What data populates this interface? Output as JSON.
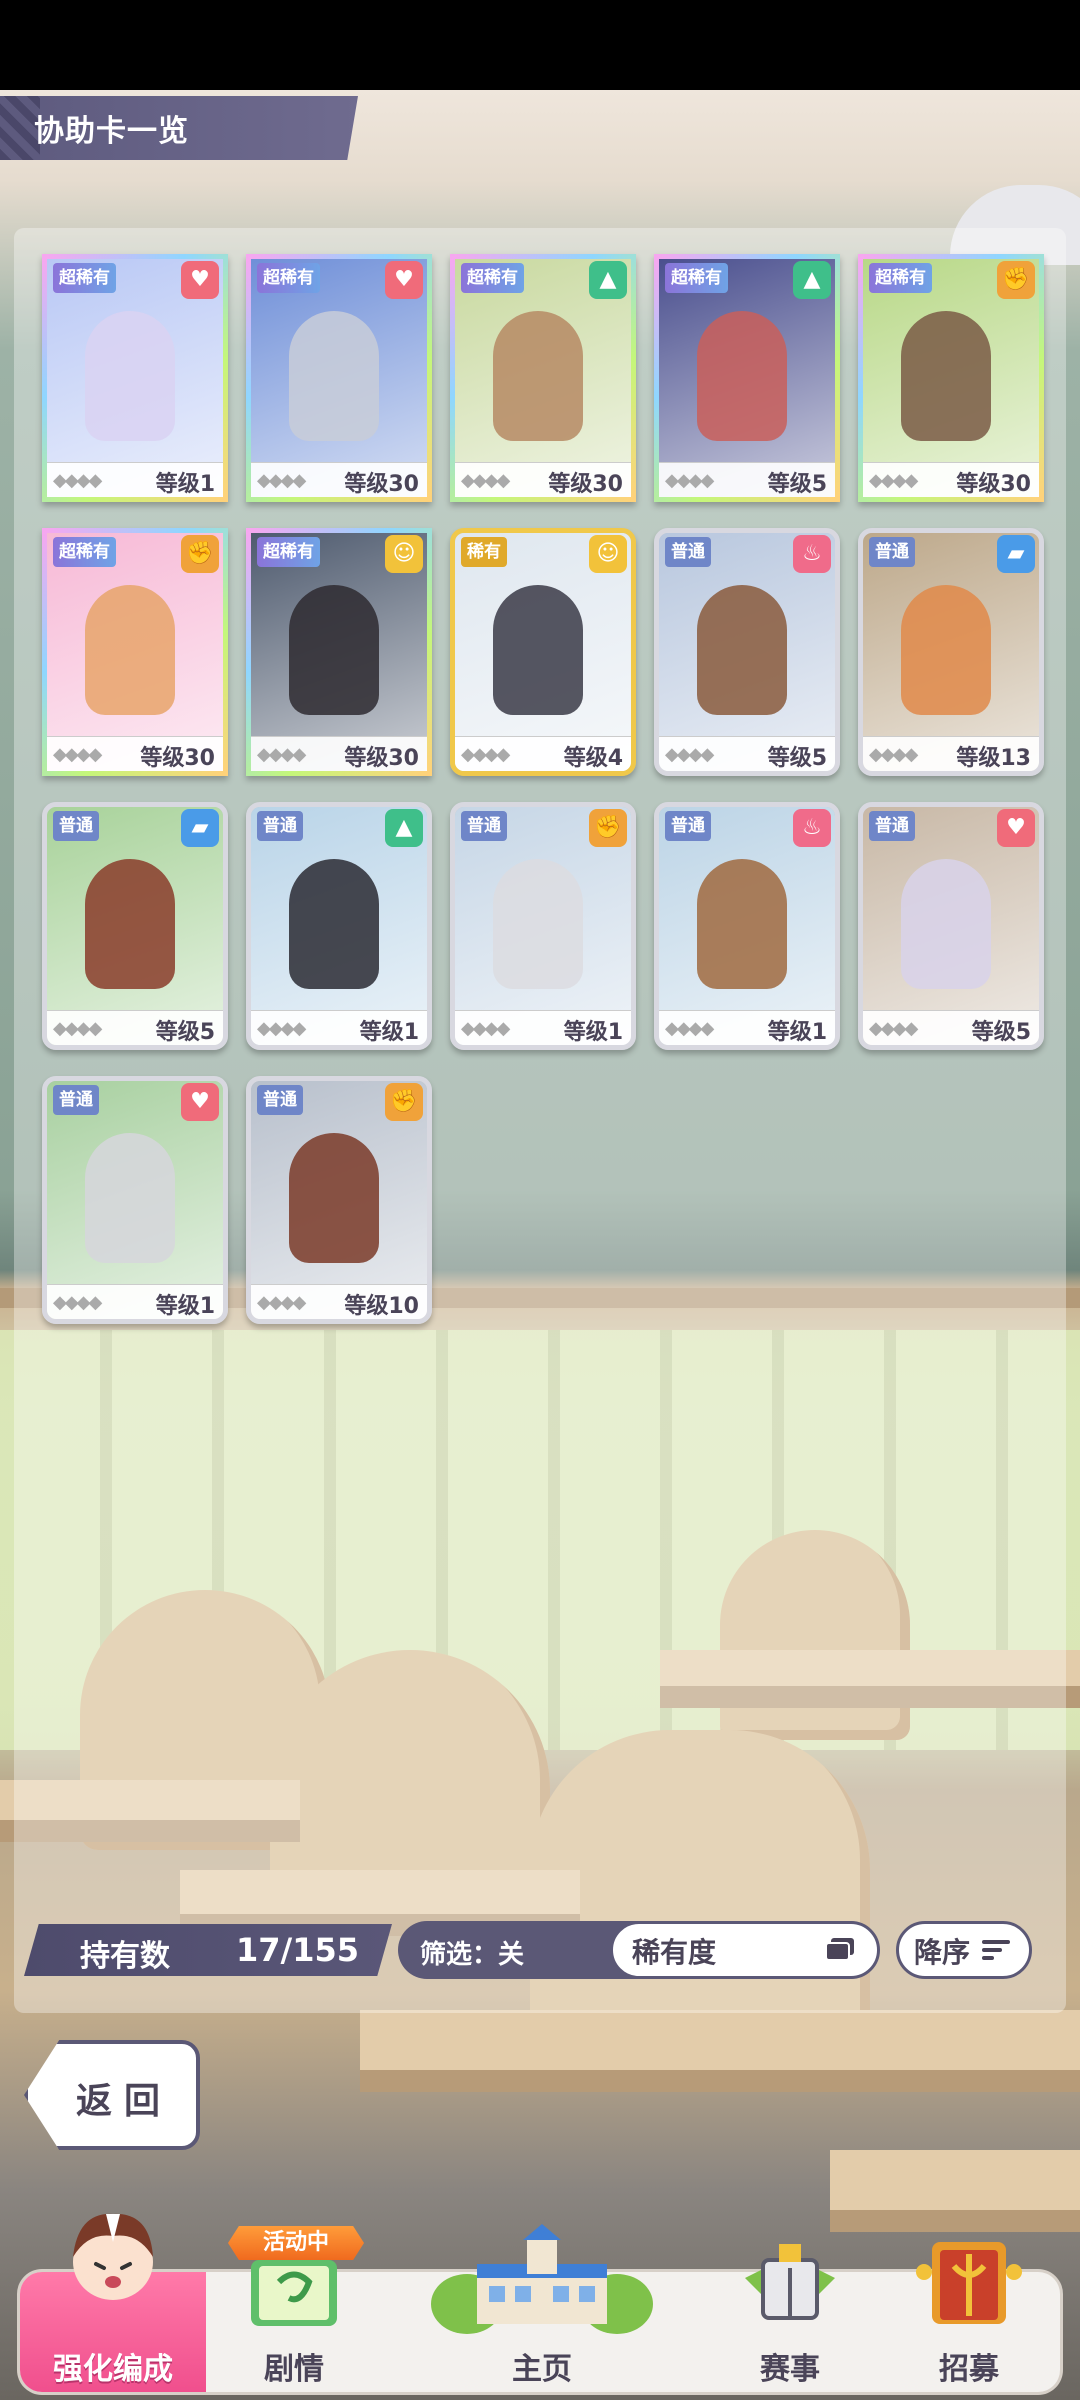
{
  "header": {
    "title": "协助卡一览"
  },
  "cards": [
    {
      "rarity": "超稀有",
      "type": "heart",
      "type_color": "#f06b7a",
      "level": "等级1",
      "art_color": "#b9c8f5",
      "char_color": "#d9d2f2",
      "tier": "ssr"
    },
    {
      "rarity": "超稀有",
      "type": "heart",
      "type_color": "#f06b7a",
      "level": "等级30",
      "art_color": "#6f8fd8",
      "char_color": "#c8cdd8",
      "tier": "ssr"
    },
    {
      "rarity": "超稀有",
      "type": "cap",
      "type_color": "#3fbf8a",
      "level": "等级30",
      "art_color": "#c9d9a0",
      "char_color": "#b68a64",
      "tier": "ssr"
    },
    {
      "rarity": "超稀有",
      "type": "cap",
      "type_color": "#3fbf8a",
      "level": "等级5",
      "art_color": "#4a4f8e",
      "char_color": "#c95f5a",
      "tier": "ssr"
    },
    {
      "rarity": "超稀有",
      "type": "muscle",
      "type_color": "#f0a23a",
      "level": "等级30",
      "art_color": "#b8d887",
      "char_color": "#7a5a45",
      "tier": "ssr"
    },
    {
      "rarity": "超稀有",
      "type": "muscle",
      "type_color": "#f0a23a",
      "level": "等级30",
      "art_color": "#f7b9d6",
      "char_color": "#e7a56b",
      "tier": "ssr"
    },
    {
      "rarity": "超稀有",
      "type": "smile",
      "type_color": "#f2c23a",
      "level": "等级30",
      "art_color": "#4e5a6e",
      "char_color": "#2e2a30",
      "tier": "ssr"
    },
    {
      "rarity": "稀有",
      "type": "smile",
      "type_color": "#f2c23a",
      "level": "等级4",
      "art_color": "#dfe7ef",
      "char_color": "#3a3a46",
      "tier": "sr"
    },
    {
      "rarity": "普通",
      "type": "fire",
      "type_color": "#f06b8a",
      "level": "等级5",
      "art_color": "#b8c7de",
      "char_color": "#8a5a3c",
      "tier": "r"
    },
    {
      "rarity": "普通",
      "type": "shoe",
      "type_color": "#4a9be8",
      "level": "等级13",
      "art_color": "#bda88a",
      "char_color": "#e08a4a",
      "tier": "r"
    },
    {
      "rarity": "普通",
      "type": "shoe",
      "type_color": "#4a9be8",
      "level": "等级5",
      "art_color": "#a8d29a",
      "char_color": "#8a3c2a",
      "tier": "r"
    },
    {
      "rarity": "普通",
      "type": "cap",
      "type_color": "#3fbf8a",
      "level": "等级1",
      "art_color": "#b9d4e8",
      "char_color": "#2a2a32",
      "tier": "r"
    },
    {
      "rarity": "普通",
      "type": "muscle",
      "type_color": "#f0a23a",
      "level": "等级1",
      "art_color": "#c6d6e6",
      "char_color": "#dcdce0",
      "tier": "r"
    },
    {
      "rarity": "普通",
      "type": "fire",
      "type_color": "#f06b8a",
      "level": "等级1",
      "art_color": "#bcd4e6",
      "char_color": "#a06a40",
      "tier": "r"
    },
    {
      "rarity": "普通",
      "type": "heart",
      "type_color": "#f06b7a",
      "level": "等级5",
      "art_color": "#c8b8a6",
      "char_color": "#d8d2ea",
      "tier": "r"
    },
    {
      "rarity": "普通",
      "type": "heart",
      "type_color": "#f06b7a",
      "level": "等级1",
      "art_color": "#a8d0a0",
      "char_color": "#d6d6dc",
      "tier": "r"
    },
    {
      "rarity": "普通",
      "type": "muscle",
      "type_color": "#f0a23a",
      "level": "等级10",
      "art_color": "#b8c0cc",
      "char_color": "#7a3a28",
      "tier": "r"
    }
  ],
  "footer": {
    "count_label": "持有数",
    "count_value": "17/155",
    "filter_label": "筛选：关",
    "rarity_button": "稀有度",
    "sort_button": "降序",
    "back_button": "返回"
  },
  "nav": {
    "event_badge": "活动中",
    "items": [
      {
        "label": "强化编成",
        "active": true
      },
      {
        "label": "剧情",
        "active": false
      },
      {
        "label": "主页",
        "active": false
      },
      {
        "label": "赛事",
        "active": false
      },
      {
        "label": "招募",
        "active": false
      }
    ]
  },
  "colors": {
    "accent_pink": "#f04f8d",
    "frame_purple": "#5b5876"
  }
}
